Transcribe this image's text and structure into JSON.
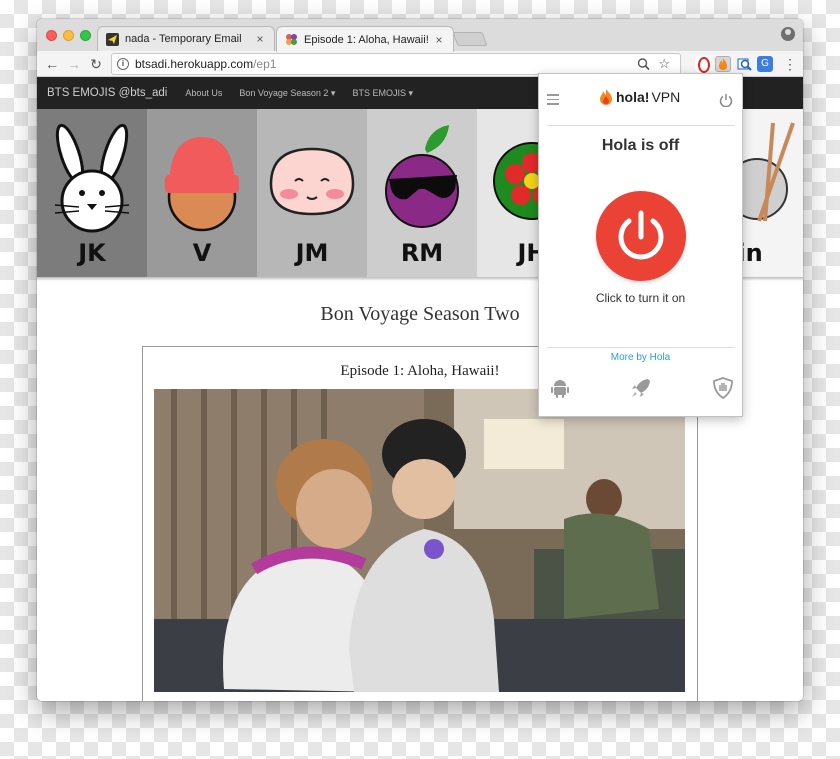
{
  "browser": {
    "tabs": [
      {
        "title": "nada - Temporary Email",
        "close": "×"
      },
      {
        "title": "Episode 1: Aloha, Hawaii!",
        "close": "×"
      }
    ],
    "url_host": "btsadi.herokuapp.com",
    "url_path": "/ep1",
    "nav": {
      "back": "←",
      "forward": "→",
      "reload": "↻",
      "menu": "⋮"
    },
    "icons": {
      "zoom": "zoom-icon",
      "star": "☆"
    }
  },
  "site": {
    "brand": "BTS EMOJIS @bts_adi",
    "nav_links": [
      "About Us",
      "Bon Voyage Season 2 ▾",
      "BTS EMOJIS ▾"
    ],
    "banner_labels": [
      "JK",
      "V",
      "JM",
      "RM",
      "JH",
      "",
      "in"
    ],
    "heading": "Bon Voyage Season Two",
    "card_title": "Episode 1: Aloha, Hawaii!"
  },
  "hola": {
    "logo_text": "hola!",
    "logo_suffix": "VPN",
    "status": "Hola is off",
    "cta": "Click to turn it on",
    "more": "More by Hola",
    "accent": "#ea4335",
    "link_color": "#2a9fd8"
  }
}
